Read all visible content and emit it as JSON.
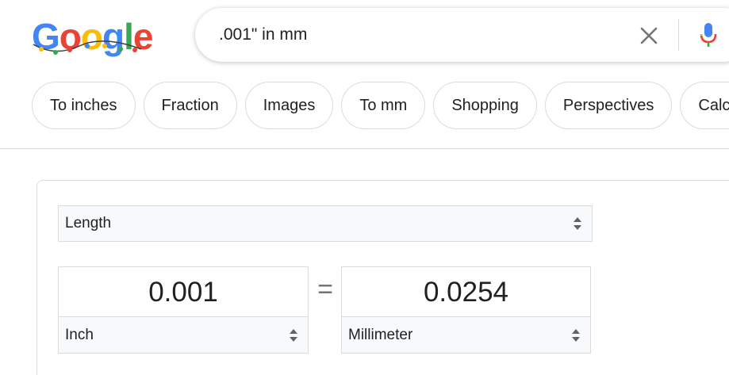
{
  "logo": {
    "letters": [
      "G",
      "o",
      "o",
      "g",
      "l",
      "e"
    ]
  },
  "search": {
    "query": ".001\" in mm"
  },
  "chips": [
    {
      "label": "To inches"
    },
    {
      "label": "Fraction"
    },
    {
      "label": "Images"
    },
    {
      "label": "To mm"
    },
    {
      "label": "Shopping"
    },
    {
      "label": "Perspectives"
    },
    {
      "label": "Calculator"
    }
  ],
  "converter": {
    "unit_type": "Length",
    "from_value": "0.001",
    "from_unit": "Inch",
    "equals": "=",
    "to_value": "0.0254",
    "to_unit": "Millimeter"
  },
  "icons": {
    "clear": "close-icon",
    "mic": "microphone-icon",
    "select_arrows": "up-down-arrows-icon"
  },
  "colors": {
    "blue": "#4285f4",
    "red": "#ea4335",
    "yellow": "#fbbc05",
    "green": "#34a853",
    "border": "#dadce0",
    "select_bg": "#f8f9fa"
  }
}
